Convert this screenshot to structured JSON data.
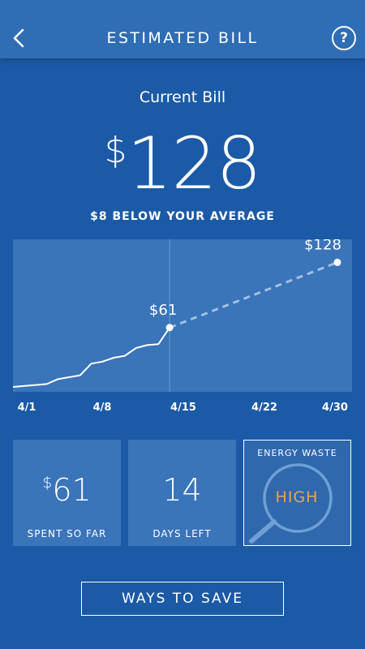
{
  "header": {
    "title": "ESTIMATED BILL",
    "back_icon": "chevron-left-icon",
    "help_label": "?"
  },
  "summary": {
    "label": "Current Bill",
    "currency": "$",
    "amount": "128",
    "comparison": "$8 BELOW YOUR AVERAGE"
  },
  "chart_data": {
    "type": "line",
    "x_tick_labels": [
      "4/1",
      "4/8",
      "4/15",
      "4/22",
      "4/30"
    ],
    "series": [
      {
        "style": "solid",
        "x": [
          1,
          2,
          3,
          4,
          5,
          6,
          7,
          8,
          9,
          10,
          11,
          12,
          13,
          14,
          15
        ],
        "y": [
          0,
          1,
          2,
          3,
          8,
          10,
          12,
          24,
          26,
          30,
          32,
          40,
          43,
          44,
          61
        ]
      },
      {
        "style": "dashed",
        "x": [
          15,
          30
        ],
        "y": [
          61,
          128
        ]
      }
    ],
    "annotations": [
      {
        "x": 15,
        "y": 61,
        "text": "$61"
      },
      {
        "x": 30,
        "y": 128,
        "text": "$128"
      }
    ],
    "xlim": [
      1,
      30
    ],
    "ylim": [
      0,
      150
    ],
    "today_marker_x": 15,
    "grid": false
  },
  "cards": {
    "spent": {
      "currency": "$",
      "value": "61",
      "label": "SPENT SO FAR"
    },
    "days": {
      "value": "14",
      "label": "DAYS LEFT"
    },
    "waste": {
      "title": "ENERGY WASTE",
      "level": "HIGH",
      "icon": "magnifier-icon",
      "level_color": "#f0a24a"
    }
  },
  "actions": {
    "save_label": "WAYS TO SAVE"
  },
  "colors": {
    "background": "#1b5aa6",
    "panel": "#3a74b9",
    "header": "#2f6db5",
    "accent": "#f0a24a"
  }
}
